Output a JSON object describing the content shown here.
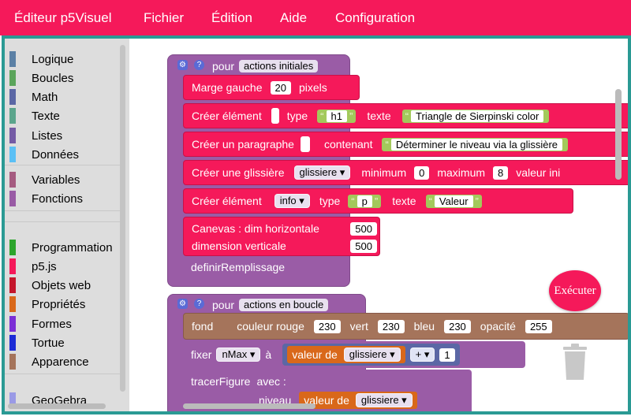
{
  "menubar": {
    "app_title": "Éditeur p5Visuel",
    "items": [
      "Fichier",
      "Édition",
      "Aide",
      "Configuration"
    ]
  },
  "toolbox": {
    "categories": [
      {
        "label": "Logique",
        "color": "#5b80a5"
      },
      {
        "label": "Boucles",
        "color": "#5ba55b"
      },
      {
        "label": "Math",
        "color": "#5b67a5"
      },
      {
        "label": "Texte",
        "color": "#5ba58c"
      },
      {
        "label": "Listes",
        "color": "#745ba5"
      },
      {
        "label": "Données",
        "color": "#5bc0f5"
      },
      {
        "label": "Variables",
        "color": "#a55b80"
      },
      {
        "label": "Fonctions",
        "color": "#995ba5"
      },
      {
        "label": "Programmation",
        "color": "#2ca52c"
      },
      {
        "label": "p5.js",
        "color": "#f5195a"
      },
      {
        "label": "Objets web",
        "color": "#c4162b"
      },
      {
        "label": "Propriétés",
        "color": "#d9681a"
      },
      {
        "label": "Formes",
        "color": "#7b2fd6"
      },
      {
        "label": "Tortue",
        "color": "#1c2bd6"
      },
      {
        "label": "Apparence",
        "color": "#a5745b"
      },
      {
        "label": "GeoGebra",
        "color": "#9a9ae6"
      }
    ]
  },
  "workspace": {
    "block1": {
      "hat_pour": "pour",
      "hat_name": "actions initiales",
      "marge_label": "Marge gauche",
      "marge_value": "20",
      "marge_unit": "pixels",
      "creer1_label": "Créer élément",
      "creer1_type": "type",
      "creer1_type_val": "h1",
      "creer1_texte": "texte",
      "creer1_texte_val": "Triangle de Sierpinski color",
      "para_label": "Créer un paragraphe",
      "para_contenant": "contenant",
      "para_val": "Déterminer le niveau via la glissière",
      "glis_label": "Créer une glissière",
      "glis_var": "glissiere",
      "glis_min": "minimum",
      "glis_min_val": "0",
      "glis_max": "maximum",
      "glis_max_val": "8",
      "glis_valeur": "valeur ini",
      "creer2_label": "Créer élément",
      "creer2_var": "info",
      "creer2_type": "type",
      "creer2_type_val": "p",
      "creer2_texte": "texte",
      "creer2_texte_val": "Valeur",
      "canvas_h": "Canevas : dim horizontale",
      "canvas_h_val": "500",
      "canvas_v": "dimension verticale",
      "canvas_v_val": "500",
      "definir": "definirRemplissage"
    },
    "block2": {
      "hat_pour": "pour",
      "hat_name": "actions en boucle",
      "fond": "fond",
      "couleur": "couleur rouge",
      "rouge_val": "230",
      "vert": "vert",
      "vert_val": "230",
      "bleu": "bleu",
      "bleu_val": "230",
      "opacite": "opacité",
      "opacite_val": "255",
      "fixer": "fixer",
      "fixer_var": "nMax",
      "a": "à",
      "valeur_de": "valeur de",
      "valeur_var": "glissiere",
      "plus": "+",
      "plus_val": "1",
      "tracer": "tracerFigure",
      "avec": "avec :",
      "niveau": "niveau",
      "valeur_de2": "valeur de",
      "valeur_var2": "glissiere"
    },
    "run_button": "Exécuter"
  }
}
